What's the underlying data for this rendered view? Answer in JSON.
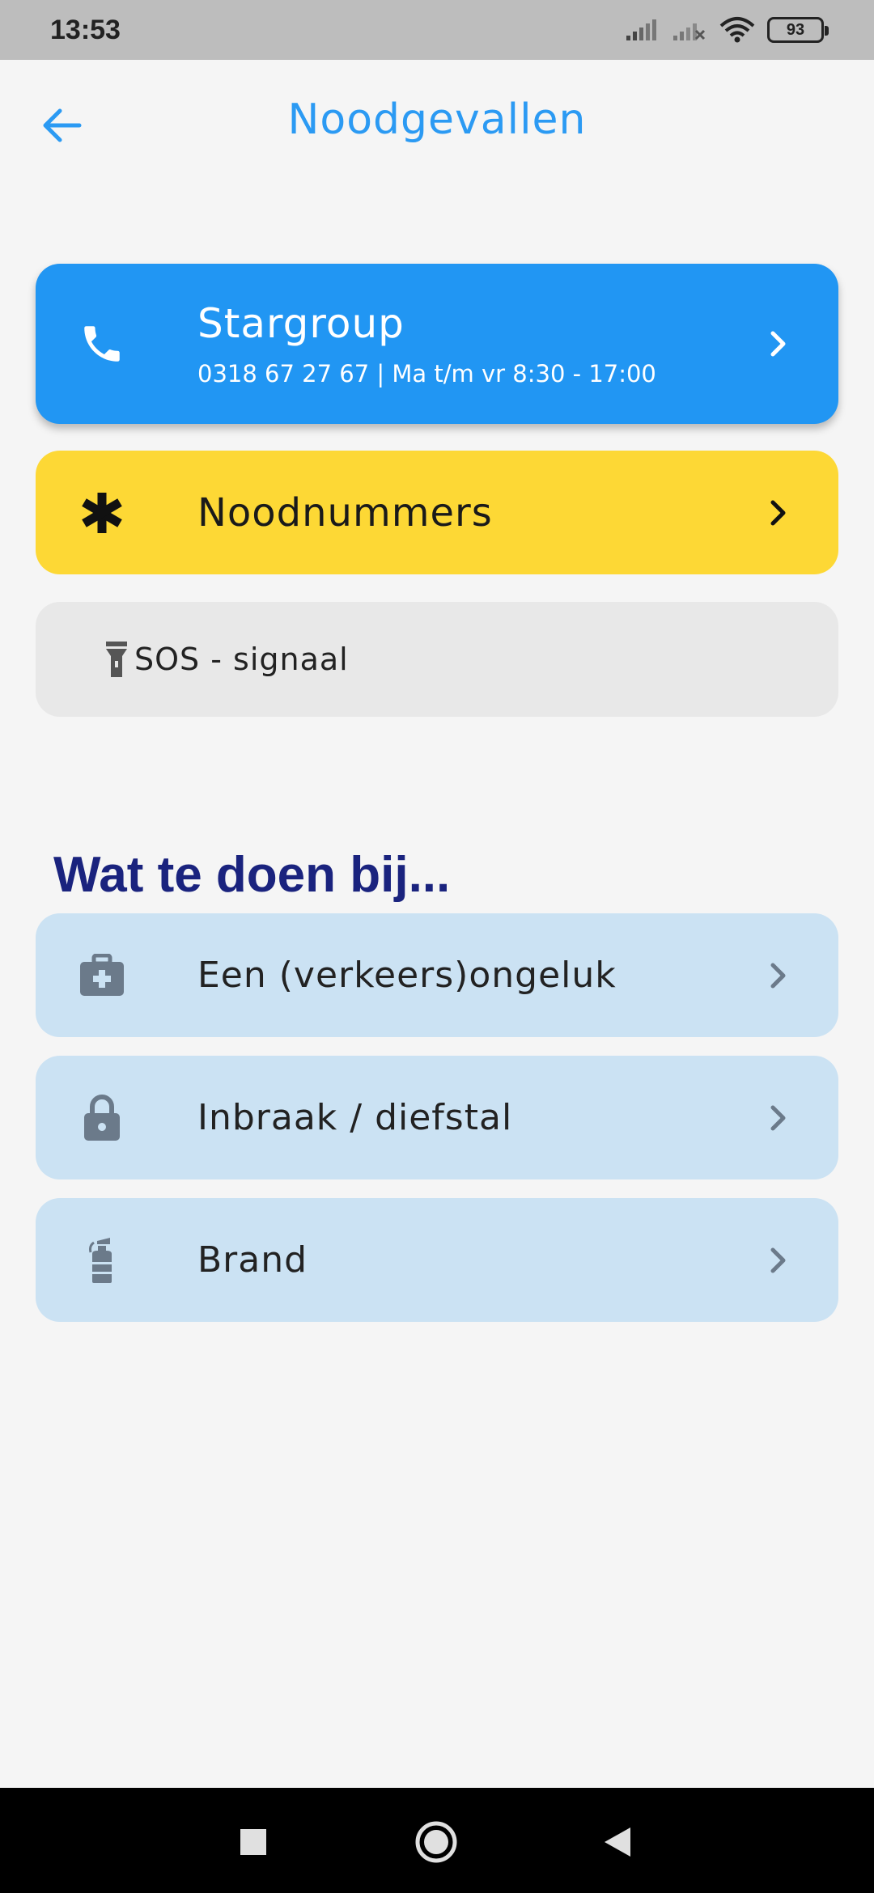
{
  "status_bar": {
    "time": "13:53",
    "battery": "93",
    "icons": [
      "signal-icon",
      "signal-off-icon",
      "wifi-icon",
      "battery-icon"
    ]
  },
  "header": {
    "title": "Noodgevallen",
    "back_icon": "arrow-left-icon"
  },
  "cards": {
    "stargroup": {
      "title": "Stargroup",
      "subtitle": "0318 67 27 67 | Ma t/m vr 8:30 - 17:00",
      "icon": "phone-icon",
      "color": "#2196f3"
    },
    "noodnummers": {
      "title": "Noodnummers",
      "icon": "asterisk-icon",
      "color": "#fdd835"
    },
    "sos": {
      "title": "SOS - signaal",
      "icon": "flashlight-icon",
      "color": "#e8e8e8"
    }
  },
  "section": {
    "title": "Wat te doen bij..."
  },
  "actions": [
    {
      "label": "Een (verkeers)ongeluk",
      "icon": "first-aid-kit-icon"
    },
    {
      "label": "Inbraak / diefstal",
      "icon": "lock-icon"
    },
    {
      "label": "Brand",
      "icon": "fire-extinguisher-icon"
    }
  ],
  "colors": {
    "accent": "#2b9af3",
    "section_title": "#1a237e",
    "action_card": "#cbe2f3"
  },
  "nav_bar": {
    "icons": [
      "recent-apps-icon",
      "home-icon",
      "back-icon"
    ]
  }
}
